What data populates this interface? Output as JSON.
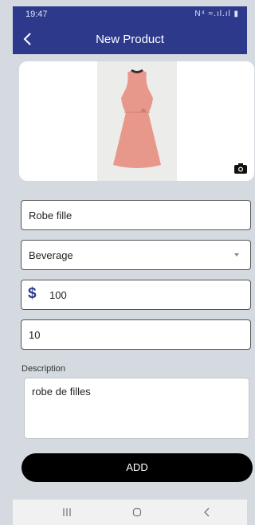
{
  "status_bar": {
    "time": "19:47",
    "icons_text": "N⁴ ≈.ıl.ıl ▮"
  },
  "app_bar": {
    "title": "New Product"
  },
  "form": {
    "name_value": "Robe fille",
    "category_value": "Beverage",
    "currency_symbol": "$",
    "price_value": "100",
    "quantity_value": "10",
    "description_label": "Description",
    "description_value": "robe de filles",
    "add_label": "ADD"
  },
  "icons": {
    "back": "back-arrow-icon",
    "camera": "camera-icon",
    "dropdown": "chevron-down-icon",
    "nav_recent": "recent-apps-icon",
    "nav_home": "home-icon",
    "nav_back": "back-icon"
  },
  "colors": {
    "primary": "#2d3a8c",
    "background": "#d4dae0",
    "button": "#000000",
    "dress": "#e8988a"
  }
}
